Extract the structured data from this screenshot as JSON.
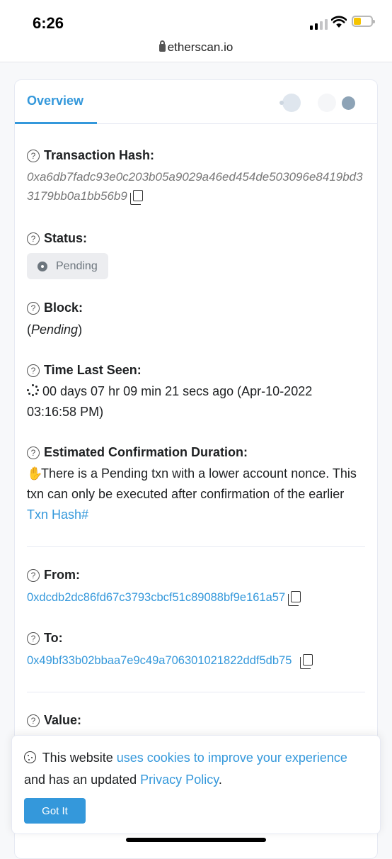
{
  "status_bar": {
    "time": "6:26",
    "url": "etherscan.io"
  },
  "tabs": {
    "overview": "Overview"
  },
  "fields": {
    "tx_hash": {
      "label": "Transaction Hash:",
      "value": "0xa6db7fadc93e0c203b05a9029a46ed454de503096e8419bd33179bb0a1bb56b9"
    },
    "status": {
      "label": "Status:",
      "value": "Pending"
    },
    "block": {
      "label": "Block:",
      "open": "(",
      "value": "Pending",
      "close": ")"
    },
    "time_last_seen": {
      "label": "Time Last Seen:",
      "value": "00 days 07 hr 09 min 21 secs ago (Apr-10-2022 03:16:58 PM)"
    },
    "est_confirmation": {
      "label": "Estimated Confirmation Duration:",
      "text": "There is a Pending txn with a lower account nonce. This txn can only be executed after confirmation of the earlier",
      "link": "Txn Hash#"
    },
    "from": {
      "label": "From:",
      "value": "0xdcdb2dc86fd67c3793cbcf51c89088bf9e161a57"
    },
    "to": {
      "label": "To:",
      "value": "0x49bf33b02bbaa7e9c49a706301021822ddf5db75"
    },
    "value": {
      "label": "Value:"
    }
  },
  "cookie_banner": {
    "text_before": "This website",
    "link1": "uses cookies to improve your experience",
    "text_mid": "and has an updated",
    "link2": "Privacy Policy",
    "text_end": ".",
    "button": "Got It"
  },
  "colors": {
    "accent": "#3498db",
    "badge_bg": "#ecedf0"
  }
}
